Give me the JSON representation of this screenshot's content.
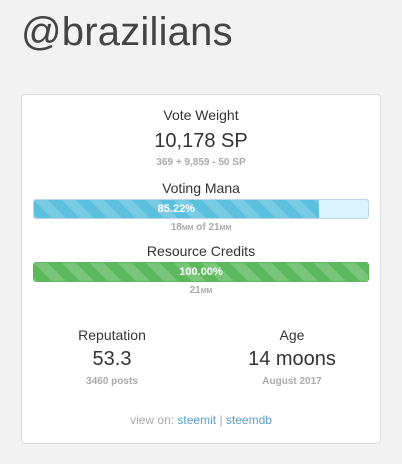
{
  "username": "@brazilians",
  "vote_weight": {
    "label": "Vote Weight",
    "value": "10,178 SP",
    "breakdown": "369 + 9,859 - 50 SP"
  },
  "voting_mana": {
    "label": "Voting Mana",
    "percent_text": "85.22%",
    "percent": 85.22,
    "detail_a": "18",
    "detail_a_unit": "MM",
    "detail_mid": " of ",
    "detail_b": "21",
    "detail_b_unit": "MM",
    "fill_color": "#5bc0de"
  },
  "resource_credits": {
    "label": "Resource Credits",
    "percent_text": "100.00%",
    "percent": 100,
    "detail": "21",
    "detail_unit": "MM",
    "fill_color": "#5cb85c"
  },
  "reputation": {
    "label": "Reputation",
    "value": "53.3",
    "sub": "3460 posts"
  },
  "age": {
    "label": "Age",
    "value": "14 moons",
    "sub": "August 2017"
  },
  "footer": {
    "prefix": "view on: ",
    "link1": "steemit",
    "separator": " | ",
    "link2": "steemdb"
  }
}
